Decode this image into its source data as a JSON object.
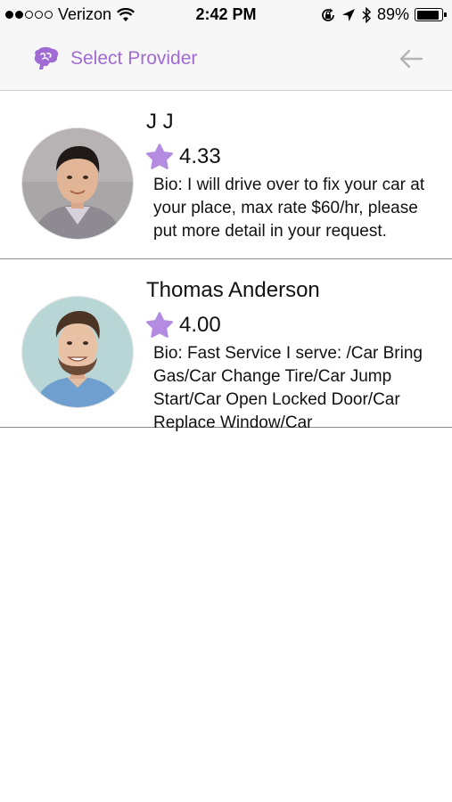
{
  "status_bar": {
    "carrier": "Verizon",
    "time": "2:42 PM",
    "battery_percent": "89%",
    "battery_level": 0.89,
    "signal_bars_filled": 2,
    "signal_bars_total": 5
  },
  "nav": {
    "title": "Select Provider",
    "logo_icon": "brain-logo-icon",
    "back_icon": "arrow-left-icon",
    "accent_color": "#a06bd2"
  },
  "providers": [
    {
      "name": "J J",
      "rating": "4.33",
      "bio": "Bio: I will drive over to fix your car at your place, max rate $60/hr, please put more detail in your request."
    },
    {
      "name": "Thomas Anderson",
      "rating": "4.00",
      "bio": "Bio: Fast Service I serve: /Car Bring Gas/Car Change Tire/Car Jump Start/Car Open Locked Door/Car Replace Window/Car"
    }
  ],
  "star_color": "#b38be0"
}
